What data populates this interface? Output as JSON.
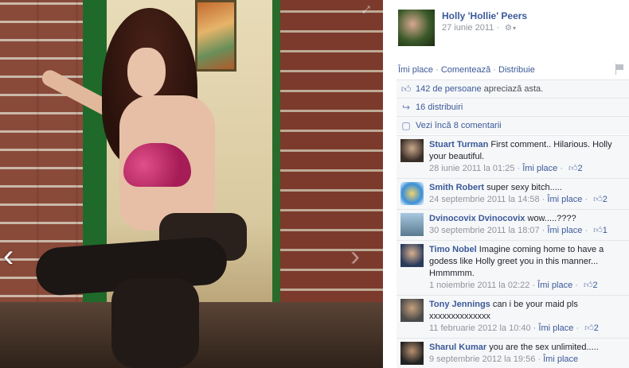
{
  "post": {
    "author": "Holly 'Hollie' Peers",
    "date": "27 iunie 2011",
    "separator": "·"
  },
  "actions": {
    "like": "Îmi place",
    "comment": "Comentează",
    "share": "Distribuie",
    "dot": "·"
  },
  "ufi": {
    "likes_link": "142 de persoane",
    "likes_text": "apreciază asta.",
    "shares": "16 distribuiri",
    "view_more": "Vezi încă 8 comentarii"
  },
  "comments": [
    {
      "author": "Stuart Turman",
      "text": "First comment.. Hilarious. Holly your beautiful.",
      "date": "28 iunie 2011 la 01:25",
      "like_label": "Îmi place",
      "likes": "2"
    },
    {
      "author": "Smith Robert",
      "text": "super sexy bitch.....",
      "date": "24 septembrie 2011 la 14:58",
      "like_label": "Îmi place",
      "likes": "2"
    },
    {
      "author": "Dvinocovix Dvinocovix",
      "text": "wow.....????",
      "date": "30 septembrie 2011 la 18:07",
      "like_label": "Îmi place",
      "likes": "1"
    },
    {
      "author": "Timo Nobel",
      "text": "Imagine coming home to have a godess like Holly greet you in this manner... Hmmmmm.",
      "date": "1 noiembrie 2011 la 02:22",
      "like_label": "Îmi place",
      "likes": "2"
    },
    {
      "author": "Tony Jennings",
      "text": "can i be your maid pls xxxxxxxxxxxxxx",
      "date": "11 februarie 2012 la 10:40",
      "like_label": "Îmi place",
      "likes": "2"
    },
    {
      "author": "Sharul Kumar",
      "text": "you are the sex unlimited.....",
      "date": "9 septembrie 2012 la 19:56",
      "like_label": "Îmi place",
      "likes": ""
    }
  ],
  "icons": {
    "prev": "chevron-left-icon",
    "next": "chevron-right-icon",
    "expand": "expand-icon",
    "gear": "gear-icon",
    "flag": "flag-icon",
    "like": "thumbs-up-icon",
    "share": "share-icon",
    "comment": "comment-icon"
  },
  "colors": {
    "link": "#3b5998",
    "meta": "#90949c",
    "ufi_bg": "#f6f7f9"
  }
}
